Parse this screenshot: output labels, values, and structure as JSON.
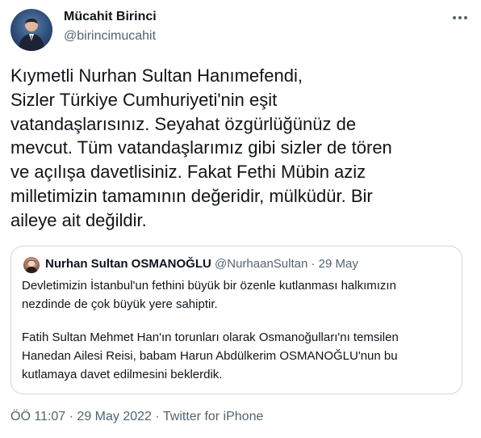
{
  "author": {
    "name": "Mücahit Birinci",
    "handle": "@birincimucahit"
  },
  "tweet_lines": [
    "Kıymetli Nurhan Sultan Hanımefendi,",
    "Sizler Türkiye Cumhuriyeti'nin eşit",
    "vatandaşlarısınız. Seyahat özgürlüğünüz de",
    "mevcut. Tüm vatandaşlarımız gibi sizler de tören",
    "ve açılışa davetlisiniz. Fakat Fethi Mübin aziz",
    "milletimizin tamamının değeridir, mülküdür. Bir",
    "aileye ait değildir."
  ],
  "quoted": {
    "name": "Nurhan Sultan OSMANOĞLU",
    "handle": "@NurhaanSultan",
    "separator": "·",
    "date": "29 May",
    "lines": [
      "Devletimizin İstanbul'un fethini büyük bir özenle kutlanması halkımızın",
      "nezdinde de çok büyük yere sahiptir.",
      "Fatih Sultan Mehmet Han'ın torunları olarak Osmanoğulları'nı temsilen",
      "Hanedan Ailesi Reisi, babam Harun Abdülkerim OSMANOĞLU'nun bu",
      "kutlamaya davet edilmesini beklerdik."
    ]
  },
  "footer": {
    "time": "ÖÖ 11:07",
    "date": "29 May 2022",
    "source": "Twitter for iPhone",
    "separator": "·"
  },
  "icons": {
    "more": "more-horizontal-icon"
  },
  "colors": {
    "text": "#0f1419",
    "secondary": "#536471",
    "border": "#cfd9de"
  }
}
